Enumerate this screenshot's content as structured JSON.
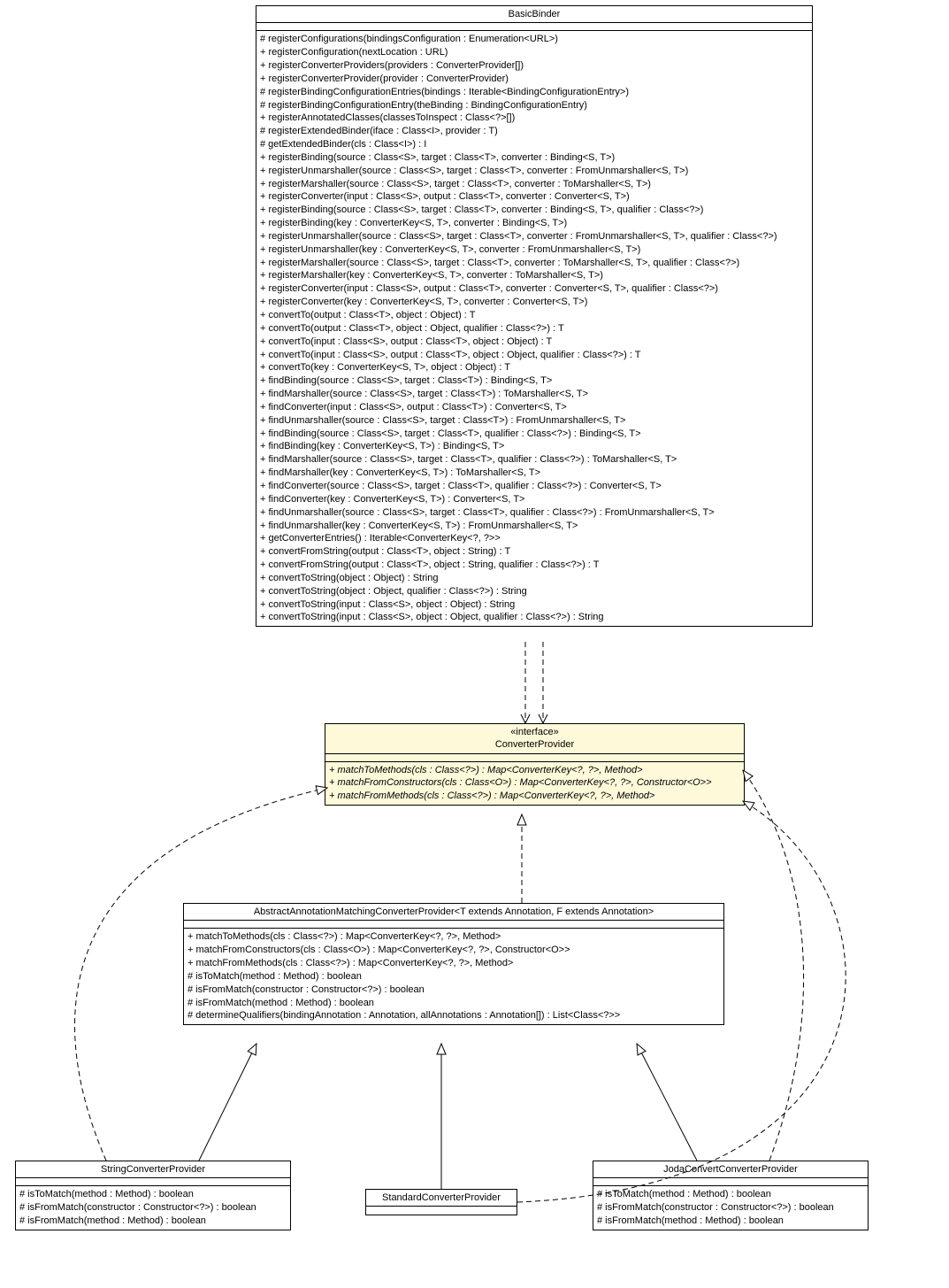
{
  "classes": {
    "basicBinder": {
      "name": "BasicBinder",
      "methods": [
        "# registerConfigurations(bindingsConfiguration : Enumeration<URL>)",
        "+ registerConfiguration(nextLocation : URL)",
        "+ registerConverterProviders(providers : ConverterProvider[])",
        "+ registerConverterProvider(provider : ConverterProvider)",
        "# registerBindingConfigurationEntries(bindings : Iterable<BindingConfigurationEntry>)",
        "# registerBindingConfigurationEntry(theBinding : BindingConfigurationEntry)",
        "+ registerAnnotatedClasses(classesToInspect : Class<?>[])",
        "# registerExtendedBinder(iface : Class<I>, provider : T)",
        "# getExtendedBinder(cls : Class<I>) : I",
        "+ registerBinding(source : Class<S>, target : Class<T>, converter : Binding<S, T>)",
        "+ registerUnmarshaller(source : Class<S>, target : Class<T>, converter : FromUnmarshaller<S, T>)",
        "+ registerMarshaller(source : Class<S>, target : Class<T>, converter : ToMarshaller<S, T>)",
        "+ registerConverter(input : Class<S>, output : Class<T>, converter : Converter<S, T>)",
        "+ registerBinding(source : Class<S>, target : Class<T>, converter : Binding<S, T>, qualifier : Class<?>)",
        "+ registerBinding(key : ConverterKey<S, T>, converter : Binding<S, T>)",
        "+ registerUnmarshaller(source : Class<S>, target : Class<T>, converter : FromUnmarshaller<S, T>, qualifier : Class<?>)",
        "+ registerUnmarshaller(key : ConverterKey<S, T>, converter : FromUnmarshaller<S, T>)",
        "+ registerMarshaller(source : Class<S>, target : Class<T>, converter : ToMarshaller<S, T>, qualifier : Class<?>)",
        "+ registerMarshaller(key : ConverterKey<S, T>, converter : ToMarshaller<S, T>)",
        "+ registerConverter(input : Class<S>, output : Class<T>, converter : Converter<S, T>, qualifier : Class<?>)",
        "+ registerConverter(key : ConverterKey<S, T>, converter : Converter<S, T>)",
        "+ convertTo(output : Class<T>, object : Object) : T",
        "+ convertTo(output : Class<T>, object : Object, qualifier : Class<?>) : T",
        "+ convertTo(input : Class<S>, output : Class<T>, object : Object) : T",
        "+ convertTo(input : Class<S>, output : Class<T>, object : Object, qualifier : Class<?>) : T",
        "+ convertTo(key : ConverterKey<S, T>, object : Object) : T",
        "+ findBinding(source : Class<S>, target : Class<T>) : Binding<S, T>",
        "+ findMarshaller(source : Class<S>, target : Class<T>) : ToMarshaller<S, T>",
        "+ findConverter(input : Class<S>, output : Class<T>) : Converter<S, T>",
        "+ findUnmarshaller(source : Class<S>, target : Class<T>) : FromUnmarshaller<S, T>",
        "+ findBinding(source : Class<S>, target : Class<T>, qualifier : Class<?>) : Binding<S, T>",
        "+ findBinding(key : ConverterKey<S, T>) : Binding<S, T>",
        "+ findMarshaller(source : Class<S>, target : Class<T>, qualifier : Class<?>) : ToMarshaller<S, T>",
        "+ findMarshaller(key : ConverterKey<S, T>) : ToMarshaller<S, T>",
        "+ findConverter(source : Class<S>, target : Class<T>, qualifier : Class<?>) : Converter<S, T>",
        "+ findConverter(key : ConverterKey<S, T>) : Converter<S, T>",
        "+ findUnmarshaller(source : Class<S>, target : Class<T>, qualifier : Class<?>) : FromUnmarshaller<S, T>",
        "+ findUnmarshaller(key : ConverterKey<S, T>) : FromUnmarshaller<S, T>",
        "+ getConverterEntries() : Iterable<ConverterKey<?, ?>>",
        "+ convertFromString(output : Class<T>, object : String) : T",
        "+ convertFromString(output : Class<T>, object : String, qualifier : Class<?>) : T",
        "+ convertToString(object : Object) : String",
        "+ convertToString(object : Object, qualifier : Class<?>) : String",
        "+ convertToString(input : Class<S>, object : Object) : String",
        "+ convertToString(input : Class<S>, object : Object, qualifier : Class<?>) : String"
      ]
    },
    "converterProvider": {
      "stereotype": "«interface»",
      "name": "ConverterProvider",
      "methods": [
        "+ matchToMethods(cls : Class<?>) : Map<ConverterKey<?, ?>, Method>",
        "+ matchFromConstructors(cls : Class<O>) : Map<ConverterKey<?, ?>, Constructor<O>>",
        "+ matchFromMethods(cls : Class<?>) : Map<ConverterKey<?, ?>, Method>"
      ]
    },
    "abstractProvider": {
      "name": "AbstractAnnotationMatchingConverterProvider<T extends Annotation, F extends Annotation>",
      "methods": [
        "+ matchToMethods(cls : Class<?>) : Map<ConverterKey<?, ?>, Method>",
        "+ matchFromConstructors(cls : Class<O>) : Map<ConverterKey<?, ?>, Constructor<O>>",
        "+ matchFromMethods(cls : Class<?>) : Map<ConverterKey<?, ?>, Method>",
        "# isToMatch(method : Method) : boolean",
        "# isFromMatch(constructor : Constructor<?>) : boolean",
        "# isFromMatch(method : Method) : boolean",
        "# determineQualifiers(bindingAnnotation : Annotation, allAnnotations : Annotation[]) : List<Class<?>>"
      ]
    },
    "stringProvider": {
      "name": "StringConverterProvider",
      "methods": [
        "# isToMatch(method : Method) : boolean",
        "# isFromMatch(constructor : Constructor<?>) : boolean",
        "# isFromMatch(method : Method) : boolean"
      ]
    },
    "standardProvider": {
      "name": "StandardConverterProvider"
    },
    "jodaProvider": {
      "name": "JodaConvertConverterProvider",
      "methods": [
        "# isToMatch(method : Method) : boolean",
        "# isFromMatch(constructor : Constructor<?>) : boolean",
        "# isFromMatch(method : Method) : boolean"
      ]
    }
  }
}
